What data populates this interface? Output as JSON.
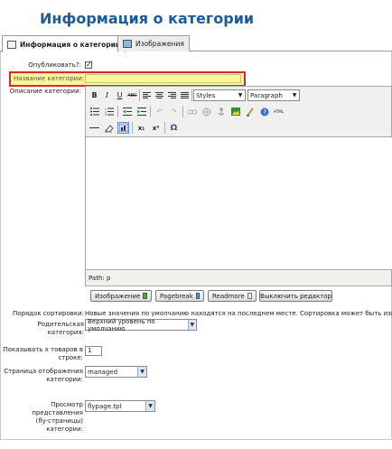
{
  "page": {
    "title": "Информация о категории"
  },
  "tabs": [
    {
      "label": "Информация о категории",
      "active": true,
      "icon": "edit-icon"
    },
    {
      "label": "Изображения",
      "active": false,
      "icon": "image-icon"
    }
  ],
  "form": {
    "published_label": "Опубликовать?:",
    "published_checked": true,
    "published_mark": "✓",
    "name_label": "Название категории:",
    "name_value": "",
    "description_label": "Описание категории:",
    "sort_label": "Порядок сортировки:",
    "sort_text": "Новые значения по умолчанию находятся на последнем месте. Сортировка может быть изменена",
    "parent_label": "Родительская категория:",
    "parent_value": "Верхний уровень по умолчанию",
    "per_row_label_1": "Показывать x товаров в",
    "per_row_label_2": "строке:",
    "per_row_value": "1",
    "browse_page_label_1": "Страница отображения",
    "browse_page_label_2": "категории:",
    "browse_page_value": "managed",
    "flypage_label_1": "Просмотр",
    "flypage_label_2": "представления",
    "flypage_label_3": "(fly-страницы)",
    "flypage_label_4": "категории:",
    "flypage_value": "flypage.tpl"
  },
  "editor": {
    "styles_value": "Styles",
    "format_value": "Paragraph",
    "path_text": "Path: p",
    "buttons": {
      "bold": "B",
      "italic": "I",
      "underline": "U",
      "strike": "ABC",
      "subscript": "x₁",
      "superscript": "x²",
      "omega": "Ω",
      "html": "HTML"
    }
  },
  "editor_buttons": {
    "image": "Изображение",
    "pagebreak": "Pagebreak",
    "readmore": "Readmore",
    "toggle": "Выключить редактор"
  },
  "colors": {
    "title": "#1d5a9a",
    "highlight": "#fdf59a",
    "highlight_border": "#d62b2b"
  }
}
